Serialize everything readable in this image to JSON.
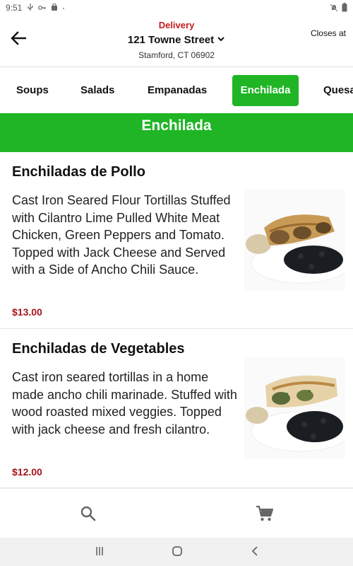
{
  "status_bar": {
    "time": "9:51",
    "icons": [
      "usb-icon",
      "key-icon",
      "bag-icon",
      "dot-icon"
    ],
    "right_icons": [
      "notifications-off-icon",
      "battery-icon"
    ]
  },
  "header": {
    "back_icon": "arrow-left-icon",
    "mode_label": "Delivery",
    "address_line": "121 Towne Street",
    "address_icon": "chevron-down-icon",
    "city_line": "Stamford, CT 06902",
    "hours_label": "Closes at"
  },
  "tabs": [
    {
      "label": "Soups"
    },
    {
      "label": "Salads"
    },
    {
      "label": "Empanadas"
    },
    {
      "label": "Enchilada"
    },
    {
      "label": "Quesa"
    }
  ],
  "active_tab": "Enchilada",
  "section": {
    "title": "Enchilada"
  },
  "menu_items": [
    {
      "name": "Enchiladas de Pollo",
      "description": "Cast Iron Seared Flour Tortillas Stuffed with Cilantro Lime Pulled White Meat Chicken, Green Peppers and Tomato. Topped with Jack Cheese and Served with a Side of Ancho Chili Sauce.",
      "price": "$13.00"
    },
    {
      "name": "Enchiladas de Vegetables",
      "description": "Cast iron seared tortillas in a home made ancho chili marinade. Stuffed with wood roasted mixed veggies. Topped with jack cheese and fresh cilantro.",
      "price": "$12.00"
    }
  ],
  "bottom_nav": {
    "items": [
      "search-icon",
      "cart-icon"
    ]
  },
  "system_nav": [
    "recents-icon",
    "home-icon",
    "back-icon"
  ],
  "colors": {
    "accent_green": "#1fb525",
    "delivery_red": "#c41c1c",
    "price_red": "#a5141c"
  }
}
